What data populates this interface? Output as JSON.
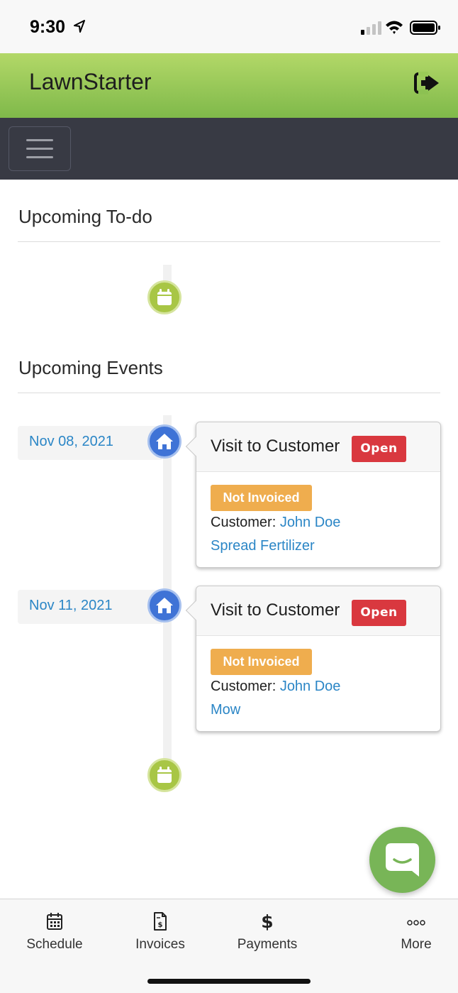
{
  "status_bar": {
    "time": "9:30"
  },
  "header": {
    "app_title": "LawnStarter"
  },
  "todo": {
    "title": "Upcoming To-do"
  },
  "events": {
    "title": "Upcoming Events",
    "items": [
      {
        "date": "Nov 08, 2021",
        "title": "Visit to Customer",
        "status": "Open",
        "invoice_status": "Not Invoiced",
        "customer_label": "Customer: ",
        "customer_name": "John Doe",
        "service": "Spread Fertilizer"
      },
      {
        "date": "Nov 11, 2021",
        "title": "Visit to Customer",
        "status": "Open",
        "invoice_status": "Not Invoiced",
        "customer_label": "Customer: ",
        "customer_name": "John Doe",
        "service": "Mow"
      }
    ]
  },
  "tabs": [
    {
      "label": "Schedule",
      "icon": "calendar-icon"
    },
    {
      "label": "Invoices",
      "icon": "invoice-icon"
    },
    {
      "label": "Payments",
      "icon": "dollar-icon"
    },
    {
      "label": "More",
      "icon": "more-icon"
    }
  ],
  "colors": {
    "header_green": "#8cc152",
    "nav_dark": "#383a44",
    "link_blue": "#2b86c6",
    "open_red": "#d9383f",
    "invoice_orange": "#efad4e",
    "chat_green": "#78b557"
  }
}
